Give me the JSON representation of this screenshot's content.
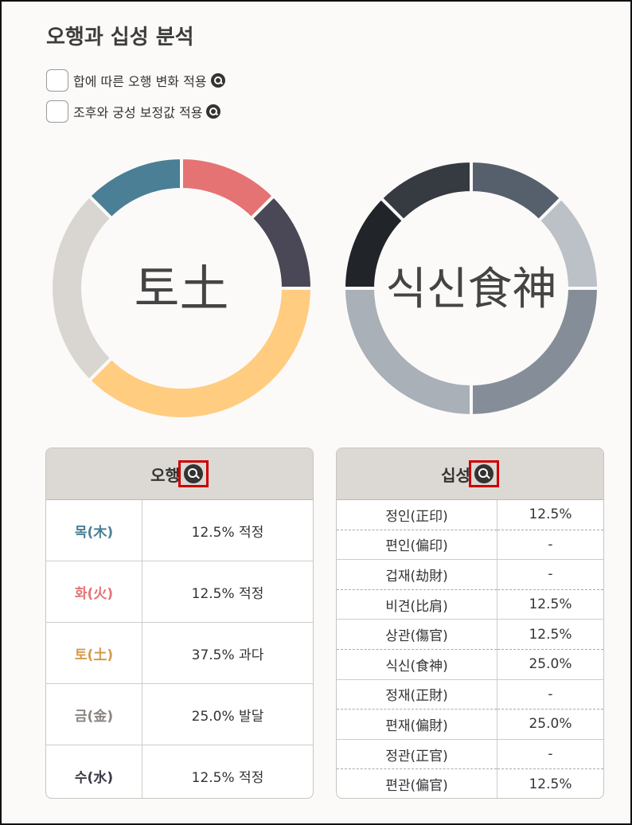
{
  "title": "오행과 십성 분석",
  "options": [
    {
      "label": "합에 따른 오행 변화 적용"
    },
    {
      "label": "조후와 궁성 보정값 적용"
    }
  ],
  "chart_data": [
    {
      "type": "pie",
      "center_label": "토土",
      "slices": [
        {
          "name": "화(火)",
          "value": 12.5,
          "color": "#e57373"
        },
        {
          "name": "수(水)",
          "value": 12.5,
          "color": "#4a4756"
        },
        {
          "name": "토(土)",
          "value": 37.5,
          "color": "#ffcc80"
        },
        {
          "name": "금(金)",
          "value": 25.0,
          "color": "#d9d6d2"
        },
        {
          "name": "목(木)",
          "value": 12.5,
          "color": "#4a7f95"
        }
      ]
    },
    {
      "type": "pie",
      "center_label": "식신食神",
      "slices": [
        {
          "name": "정인(正印)",
          "value": 12.5,
          "color": "#56606c"
        },
        {
          "name": "비견(比肩)",
          "value": 12.5,
          "color": "#bcc1c8"
        },
        {
          "name": "편재(偏財)",
          "value": 25.0,
          "color": "#858e98"
        },
        {
          "name": "식신(食神)",
          "value": 25.0,
          "color": "#a9b0b7"
        },
        {
          "name": "상관(傷官)",
          "value": 12.5,
          "color": "#212428"
        },
        {
          "name": "편관(偏官)",
          "value": 12.5,
          "color": "#363a41"
        }
      ]
    }
  ],
  "ohaeng_table": {
    "header": "오행",
    "rows": [
      {
        "label": "목(木)",
        "value": "12.5% 적정",
        "color": "#4a7f95"
      },
      {
        "label": "화(火)",
        "value": "12.5% 적정",
        "color": "#e57373"
      },
      {
        "label": "토(土)",
        "value": "37.5% 과다",
        "color": "#d49a4a"
      },
      {
        "label": "금(金)",
        "value": "25.0% 발달",
        "color": "#8a8580"
      },
      {
        "label": "수(水)",
        "value": "12.5% 적정",
        "color": "#3d3a46"
      }
    ]
  },
  "sipseong_table": {
    "header": "십성",
    "rows": [
      {
        "label": "정인(正印)",
        "value": "12.5%"
      },
      {
        "label": "편인(偏印)",
        "value": "-"
      },
      {
        "label": "겁재(劫財)",
        "value": "-"
      },
      {
        "label": "비견(比肩)",
        "value": "12.5%"
      },
      {
        "label": "상관(傷官)",
        "value": "12.5%"
      },
      {
        "label": "식신(食神)",
        "value": "25.0%"
      },
      {
        "label": "정재(正財)",
        "value": "-"
      },
      {
        "label": "편재(偏財)",
        "value": "25.0%"
      },
      {
        "label": "정관(正官)",
        "value": "-"
      },
      {
        "label": "편관(偏官)",
        "value": "12.5%"
      }
    ]
  }
}
